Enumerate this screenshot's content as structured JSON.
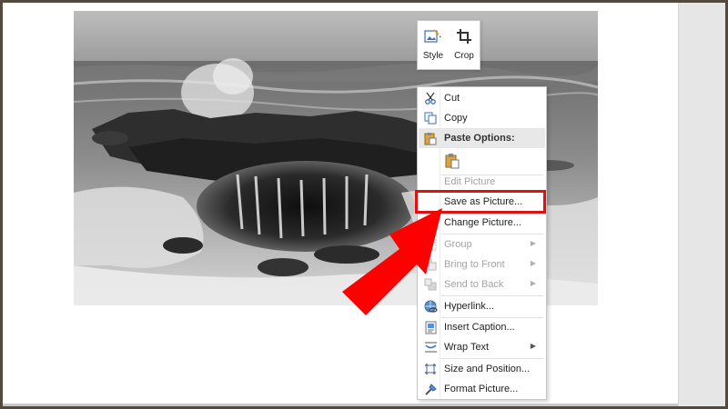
{
  "mini_toolbar": {
    "style_label": "Style",
    "crop_label": "Crop"
  },
  "context_menu": {
    "cut": "Cut",
    "copy": "Copy",
    "paste_options": "Paste Options:",
    "edit_picture": "Edit Picture",
    "save_as_picture": "Save as Picture...",
    "change_picture": "Change Picture...",
    "group": "Group",
    "bring_to_front": "Bring to Front",
    "send_to_back": "Send to Back",
    "hyperlink": "Hyperlink...",
    "insert_caption": "Insert Caption...",
    "wrap_text": "Wrap Text",
    "size_and_position": "Size and Position...",
    "format_picture": "Format Picture..."
  },
  "colors": {
    "highlight": "#e01010",
    "arrow": "#ff0000",
    "frame": "#514a3d"
  }
}
